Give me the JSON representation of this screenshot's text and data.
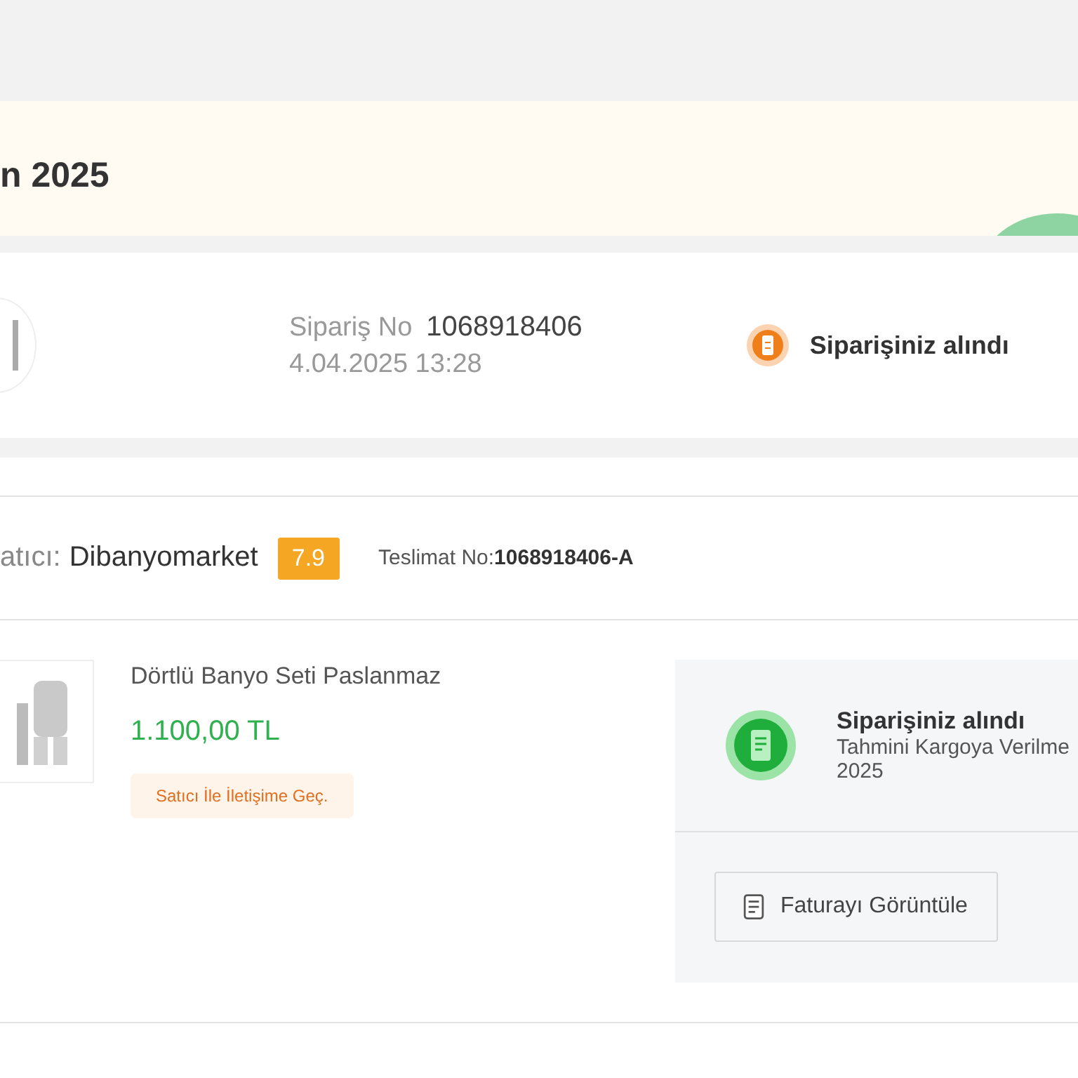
{
  "banner": {
    "title": "n 2025"
  },
  "order": {
    "number_label": "Sipariş No",
    "number": "1068918406",
    "date": "4.04.2025 13:28",
    "status": "Siparişiniz alındı"
  },
  "seller": {
    "label": "atıcı:",
    "name": "Dibanyomarket",
    "score": "7.9",
    "delivery_label": "Teslimat No:",
    "delivery_no": "1068918406-A"
  },
  "product": {
    "title": "Dörtlü Banyo Seti Paslanmaz",
    "price": "1.100,00 TL",
    "contact": "Satıcı İle İletişime Geç."
  },
  "shipment": {
    "status": "Siparişiniz alındı",
    "estimate": "Tahmini Kargoya Verilme",
    "estimate_line2": "2025",
    "invoice_button": "Faturayı Görüntüle"
  }
}
